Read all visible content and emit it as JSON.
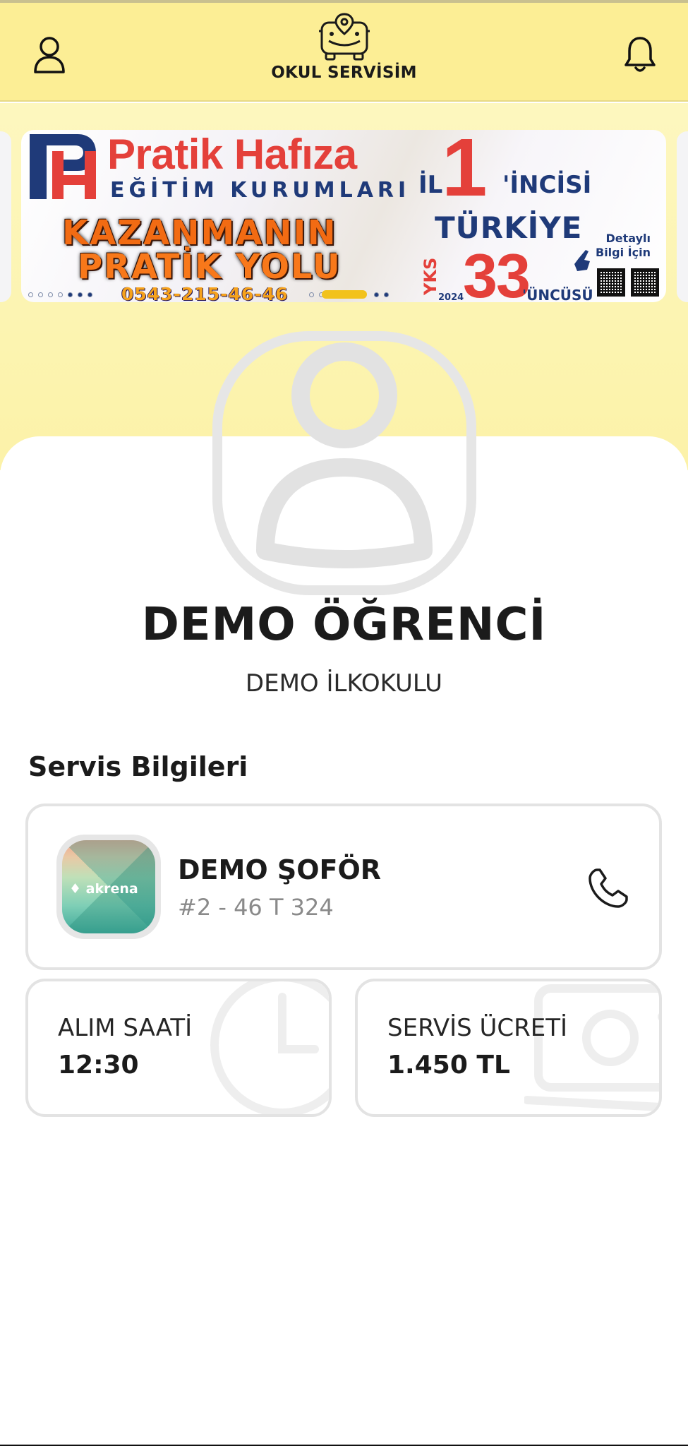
{
  "header": {
    "app_title": "OKUL SERVİSİM",
    "profile_icon": "user-icon",
    "notification_icon": "bell-icon",
    "logo_icon": "bus-icon"
  },
  "banner": {
    "brand_name": "Pratik Hafıza",
    "brand_sub": "EĞİTİM KURUMLARI",
    "slogan_line1": "KAZANMANIN",
    "slogan_line2": "PRATİK YOLU",
    "phone": "0543-215-46-46",
    "il": "İL",
    "rank_one": "1",
    "rank_one_suffix": "'İNCİSİ",
    "country": "TÜRKİYE",
    "exam": "YKS",
    "year": "2024",
    "rank_two": "33",
    "rank_two_suffix": "'ÜNCÜSÜ",
    "detail_line1": "Detaylı",
    "detail_line2": "Bilgi İçin",
    "colors": {
      "red": "#e4403a",
      "navy": "#1f3a79",
      "orange": "#f26b13"
    }
  },
  "carousel": {
    "active_indicator_color": "#f2c21b"
  },
  "student": {
    "name": "DEMO ÖĞRENCİ",
    "school": "DEMO İLKOKULU",
    "avatar_icon": "avatar-placeholder-icon"
  },
  "service": {
    "section_title": "Servis Bilgileri",
    "driver": {
      "name": "DEMO ŞOFÖR",
      "plate": "#2 - 46 T 324",
      "logo_text": "akrena",
      "call_icon": "phone-icon"
    },
    "pickup": {
      "label": "ALIM SAATİ",
      "value": "12:30",
      "icon": "clock-icon"
    },
    "fee": {
      "label": "SERVİS ÜCRETİ",
      "value": "1.450 TL",
      "icon": "money-icon"
    }
  },
  "theme": {
    "header_bg": "#fcee95",
    "band_bg": "#fdf5b5",
    "card_border": "#e3e3e3"
  }
}
